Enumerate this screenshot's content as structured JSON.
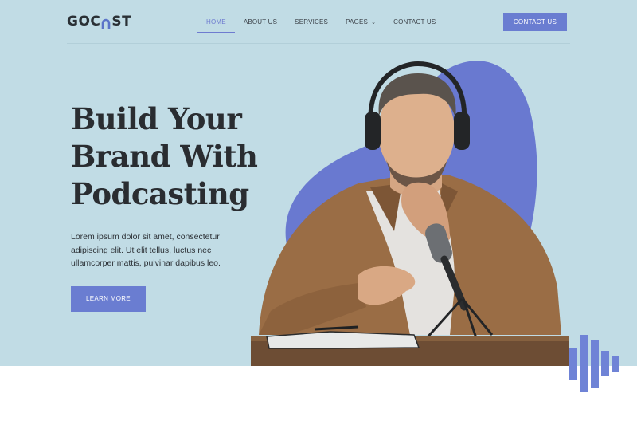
{
  "brand": {
    "logo_text_left": "GOC",
    "logo_text_right": "ST"
  },
  "nav": {
    "items": [
      {
        "label": "HOME",
        "active": true
      },
      {
        "label": "ABOUT US",
        "active": false
      },
      {
        "label": "SERVICES",
        "active": false
      },
      {
        "label": "PAGES",
        "active": false,
        "has_dropdown": true
      },
      {
        "label": "CONTACT US",
        "active": false
      }
    ],
    "dropdown_icon": "chevron-down-icon"
  },
  "header_cta": {
    "label": "CONTACT US"
  },
  "hero": {
    "headline_lines": [
      "Build Your",
      "Brand With",
      "Podcasting"
    ],
    "description": "Lorem ipsum dolor sit amet, consectetur adipiscing elit. Ut elit tellus, luctus nec ullamcorper mattis, pulvinar dapibus leo.",
    "cta_label": "LEARN MORE"
  },
  "colors": {
    "hero_background": "#c1dce5",
    "accent": "#6a7dd1",
    "text_dark": "#2a2d31"
  }
}
